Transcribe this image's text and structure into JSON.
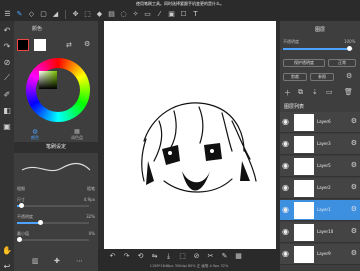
{
  "hint": "使用笔刷工具。同时选择要跟手机变更的是什么。",
  "toolbar": {
    "icons": [
      "menu-icon",
      "pen-icon",
      "eraser-icon",
      "select-rect-icon",
      "fill-icon",
      "move-icon",
      "transform-icon",
      "lasso-icon",
      "magic-wand-icon",
      "eyedropper-icon",
      "text-icon"
    ]
  },
  "left_panel": {
    "color_title": "颜色",
    "tabs": [
      {
        "label": "颜色",
        "active": true
      },
      {
        "label": "调色盘",
        "active": false
      }
    ],
    "brush_title": "笔刷设定",
    "params": {
      "pressure_left": "粗细",
      "pressure_right": "粗笔",
      "size_label": "尺寸",
      "size_value": "4.9px",
      "opacity_label": "不透明度",
      "opacity_value": "32%",
      "min_label": "最小值",
      "min_value": "0%",
      "size_pct": 5,
      "opacity_pct": 32,
      "min_pct": 0
    }
  },
  "bottombar": {
    "status": "1158*1648px 350dpi 80% 正 画笔 4.9px 32%"
  },
  "right_panel": {
    "title": "图层",
    "opacity_label": "不透明度",
    "opacity_value": "100%",
    "protect_label": "保护透明度",
    "blend_label": "正常",
    "clipping_label": "剪裁",
    "ref_label": "参照",
    "layers_title": "图层列表",
    "layers": [
      {
        "name": "Layer6",
        "selected": false
      },
      {
        "name": "Layer3",
        "selected": false
      },
      {
        "name": "Layer5",
        "selected": false
      },
      {
        "name": "Layer2",
        "selected": false
      },
      {
        "name": "Layer1",
        "selected": true
      },
      {
        "name": "Layer10",
        "selected": false
      },
      {
        "name": "Layer9",
        "selected": false
      }
    ]
  }
}
